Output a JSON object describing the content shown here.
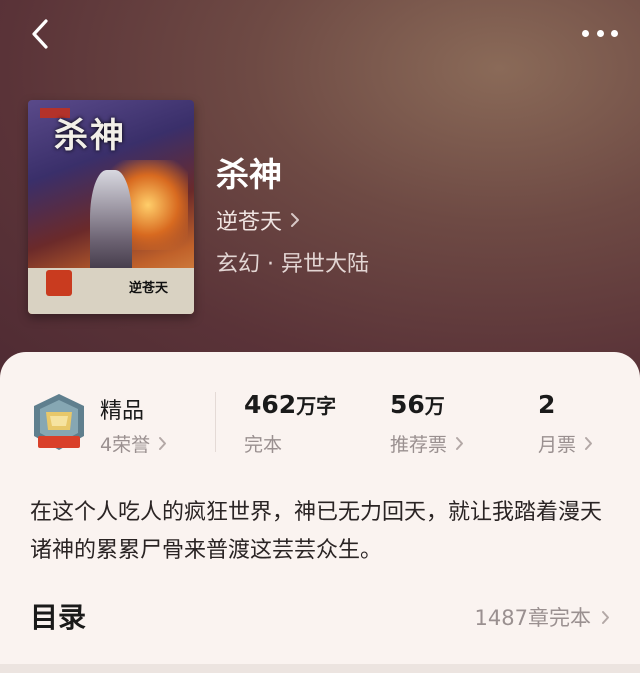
{
  "book": {
    "title": "杀神",
    "author": "逆苍天",
    "genre": "玄幻 · 异世大陆",
    "cover_title": "杀神",
    "cover_author": "逆苍天"
  },
  "stats": {
    "honor": {
      "label": "精品",
      "sub": "4荣誉"
    },
    "words": {
      "value": "462",
      "unit": "万字",
      "sub": "完本"
    },
    "recommend": {
      "value": "56",
      "unit": "万",
      "sub": "推荐票"
    },
    "monthly": {
      "value": "2",
      "sub": "月票"
    }
  },
  "description": "在这个人吃人的疯狂世界，神已无力回天，就让我踏着漫天诸神的累累尸骨来普渡这芸芸众生。",
  "toc": {
    "title": "目录",
    "info": "1487章完本"
  },
  "icons": {
    "back": "back-chevron-icon",
    "more": "more-dots-icon",
    "honor": "honor-badge-icon",
    "chevron": "chevron-right-icon"
  },
  "colors": {
    "header_bg": "#5a3338",
    "panel_bg": "#faf3f0",
    "muted_text": "#9a9090"
  }
}
